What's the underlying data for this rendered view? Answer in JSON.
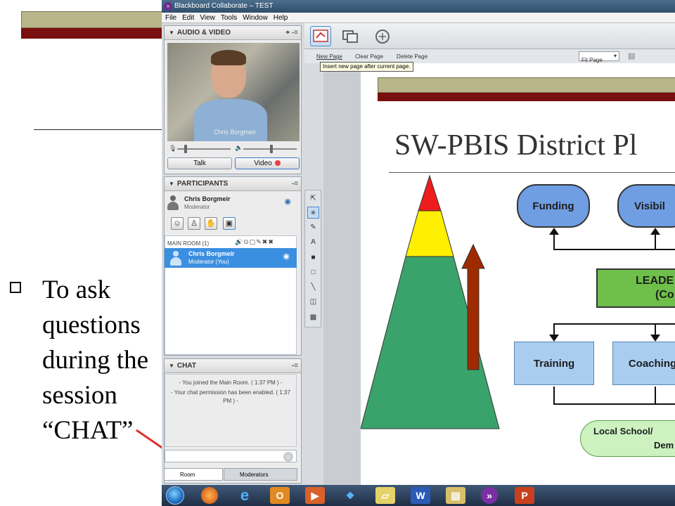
{
  "slide": {
    "bullet_text": "To ask questions during the session “CHAT”"
  },
  "window": {
    "title": "Blackboard Collaborate – TEST",
    "menu": [
      "File",
      "Edit",
      "View",
      "Tools",
      "Window",
      "Help"
    ]
  },
  "audio_video": {
    "header": "AUDIO & VIDEO",
    "video_name": "Chris Borgmeir",
    "talk_label": "Talk",
    "video_label": "Video"
  },
  "participants": {
    "header": "PARTICIPANTS",
    "current_user": {
      "name": "Chris Borgmeir",
      "role": "Moderator"
    },
    "room_label": "MAIN ROOM",
    "room_count": "(1)",
    "list": [
      {
        "name": "Chris Borgmeir",
        "role": "Moderator (You)"
      }
    ]
  },
  "chat": {
    "header": "CHAT",
    "messages": [
      "- You joined the Main Room. ( 1:37 PM ) -",
      "- Your chat permission has been enabled. ( 1:37 PM ) -"
    ],
    "tabs": [
      "Room",
      "Moderators"
    ]
  },
  "whiteboard": {
    "new_page": "New Page",
    "clear_page": "Clear Page",
    "delete_page": "Delete Page",
    "zoom": "Fit Page",
    "tooltip": "Insert new page after current page."
  },
  "inner_slide": {
    "title": "SW-PBIS District Pl",
    "nodes": {
      "funding": "Funding",
      "visibility": "Visibil",
      "leadership": "LEADE",
      "leadership_sub": "(Co",
      "training": "Training",
      "coaching": "Coaching",
      "local": "Local School/",
      "local_sub": "Dem"
    }
  },
  "colors": {
    "slide_gold": "#b9b58a",
    "slide_red": "#7a0f0f",
    "selected_row": "#3b8fe0",
    "pyramid_red": "#ee1c1c",
    "pyramid_yellow": "#ffef00",
    "pyramid_green": "#3aa36b",
    "arrow_brown": "#9e2a00"
  }
}
